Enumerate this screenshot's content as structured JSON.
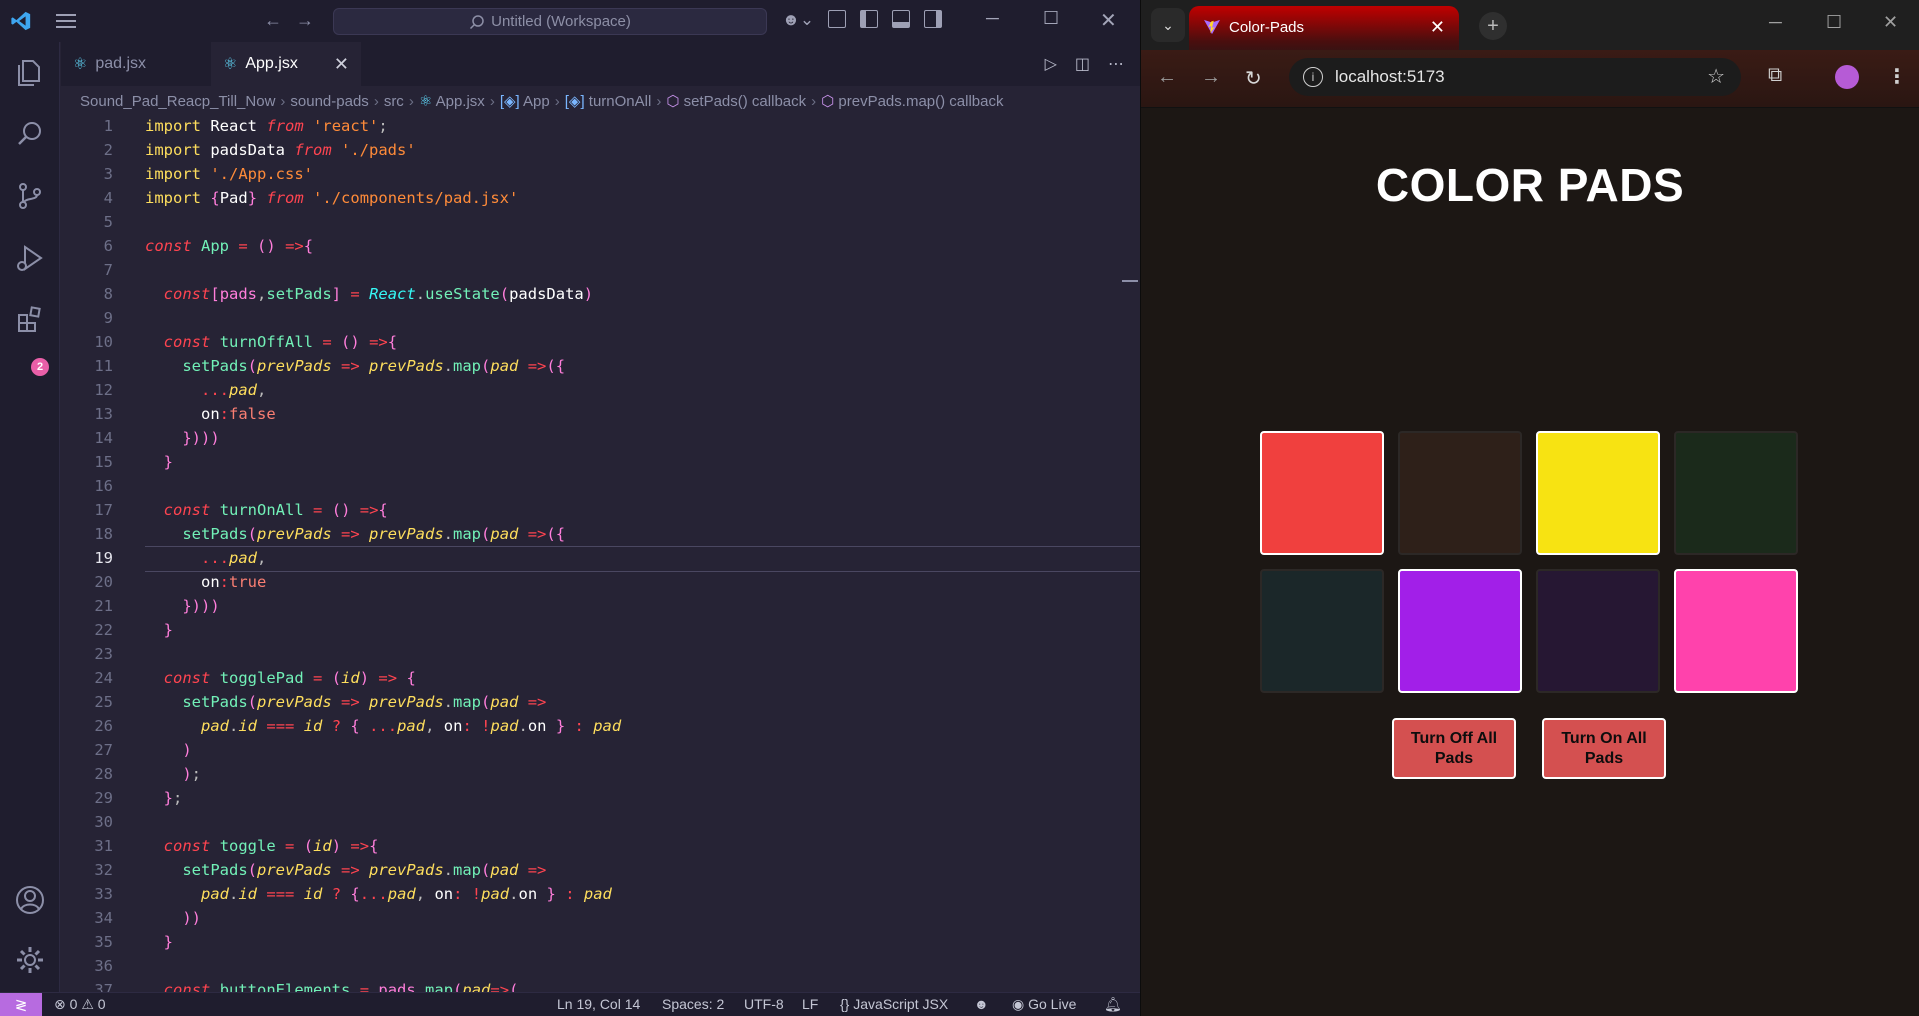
{
  "vscode": {
    "search_text": "Untitled (Workspace)",
    "tabs": [
      {
        "label": "pad.jsx"
      },
      {
        "label": "App.jsx"
      }
    ],
    "breadcrumb": [
      "Sound_Pad_Reacp_Till_Now",
      "sound-pads",
      "src",
      "App.jsx",
      "App",
      "turnOnAll",
      "setPads() callback",
      "prevPads.map() callback"
    ],
    "activity_badge": "2",
    "current_line": 19,
    "code_lines": [
      "import React from 'react';",
      "import padsData from './pads'",
      "import './App.css'",
      "import {Pad} from './components/pad.jsx'",
      "",
      "const App = () =>{",
      "",
      "  const[pads,setPads] = React.useState(padsData)",
      "",
      "  const turnOffAll = () =>{",
      "    setPads(prevPads => prevPads.map(pad =>({",
      "      ...pad,",
      "      on:false",
      "    })))",
      "  }",
      "",
      "  const turnOnAll = () =>{",
      "    setPads(prevPads => prevPads.map(pad =>({",
      "      ...pad,",
      "      on:true",
      "    })))",
      "  }",
      "",
      "  const togglePad = (id) => {",
      "    setPads(prevPads => prevPads.map(pad =>",
      "      pad.id === id ? { ...pad, on: !pad.on } : pad",
      "    )",
      "    );",
      "  };",
      "",
      "  const toggle = (id) =>{",
      "    setPads(prevPads => prevPads.map(pad =>",
      "      pad.id === id ? {...pad, on: !pad.on } : pad",
      "    ))",
      "  }",
      "",
      "  const buttonElements = pads.map(pad=>("
    ],
    "status": {
      "errors": "0",
      "warnings": "0",
      "position": "Ln 19, Col 14",
      "spaces": "Spaces: 2",
      "encoding": "UTF-8",
      "eol": "LF",
      "language": "JavaScript JSX",
      "golive": "Go Live"
    }
  },
  "browser": {
    "tab_title": "Color-Pads",
    "url": "localhost:5173",
    "page": {
      "title": "COLOR PADS",
      "pads": [
        {
          "color": "#f0403e",
          "on": true
        },
        {
          "color": "#2e2019",
          "on": false
        },
        {
          "color": "#f7e312",
          "on": true
        },
        {
          "color": "#1b2a1b",
          "on": false
        },
        {
          "color": "#1b2729",
          "on": false
        },
        {
          "color": "#a21fe8",
          "on": true
        },
        {
          "color": "#261733",
          "on": false
        },
        {
          "color": "#ff42ac",
          "on": true
        }
      ],
      "btn_off": "Turn Off All Pads",
      "btn_on": "Turn On All Pads"
    }
  }
}
